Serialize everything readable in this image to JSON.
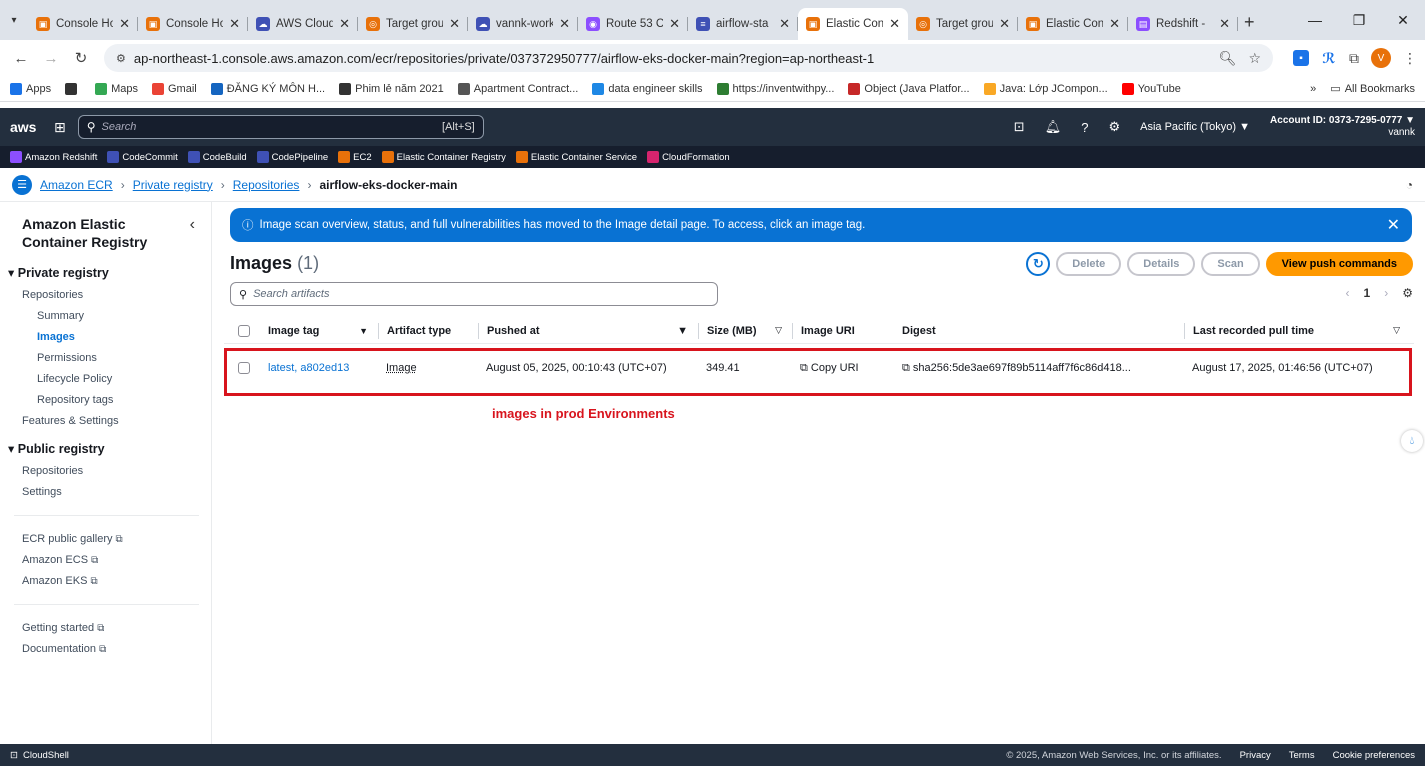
{
  "browser": {
    "tabs": [
      {
        "label": "Console Ho",
        "color": "#e8710a",
        "glyph": "▣"
      },
      {
        "label": "Console Ho",
        "color": "#e8710a",
        "glyph": "▣"
      },
      {
        "label": "AWS Cloud",
        "color": "#3f51b5",
        "glyph": "☁"
      },
      {
        "label": "Target grou",
        "color": "#e8710a",
        "glyph": "◎"
      },
      {
        "label": "vannk-work",
        "color": "#3f51b5",
        "glyph": "☁"
      },
      {
        "label": "Route 53 C",
        "color": "#8c4fff",
        "glyph": "◉"
      },
      {
        "label": "airflow-sta",
        "color": "#3f51b5",
        "glyph": "≡"
      },
      {
        "label": "Elastic Cont",
        "color": "#e8710a",
        "glyph": "▣",
        "active": true
      },
      {
        "label": "Target grou",
        "color": "#e8710a",
        "glyph": "◎"
      },
      {
        "label": "Elastic Con",
        "color": "#e8710a",
        "glyph": "▣"
      },
      {
        "label": "Redshift -",
        "color": "#8c4fff",
        "glyph": "▤"
      }
    ],
    "url": "ap-northeast-1.console.aws.amazon.com/ecr/repositories/private/037372950777/airflow-eks-docker-main?region=ap-northeast-1",
    "profile_initial": "V",
    "bookmarks": [
      {
        "label": "Apps",
        "color": "#1a73e8"
      },
      {
        "label": "",
        "color": "#333"
      },
      {
        "label": "Maps",
        "color": "#34a853"
      },
      {
        "label": "Gmail",
        "color": "#ea4335"
      },
      {
        "label": "ĐĂNG KÝ MÔN H...",
        "color": "#1565c0"
      },
      {
        "label": "Phim lẻ năm 2021",
        "color": "#333"
      },
      {
        "label": "Apartment Contract...",
        "color": "#555"
      },
      {
        "label": "data engineer skills",
        "color": "#1e88e5"
      },
      {
        "label": "https://inventwithpy...",
        "color": "#2e7d32"
      },
      {
        "label": "Object (Java Platfor...",
        "color": "#c62828"
      },
      {
        "label": "Java: Lớp JCompon...",
        "color": "#f9a825"
      },
      {
        "label": "YouTube",
        "color": "#ff0000"
      }
    ],
    "all_bookmarks": "All Bookmarks"
  },
  "aws_header": {
    "logo": "aws",
    "search_placeholder": "Search",
    "search_shortcut": "[Alt+S]",
    "region": "Asia Pacific (Tokyo) ▼",
    "account_id": "Account ID: 0373-7295-0777 ▼",
    "user": "vannk",
    "favorites": [
      {
        "label": "Amazon Redshift",
        "color": "#8c4fff"
      },
      {
        "label": "CodeCommit",
        "color": "#3f51b5"
      },
      {
        "label": "CodeBuild",
        "color": "#3f51b5"
      },
      {
        "label": "CodePipeline",
        "color": "#3f51b5"
      },
      {
        "label": "EC2",
        "color": "#e8710a"
      },
      {
        "label": "Elastic Container Registry",
        "color": "#e8710a"
      },
      {
        "label": "Elastic Container Service",
        "color": "#e8710a"
      },
      {
        "label": "CloudFormation",
        "color": "#d6246e"
      }
    ]
  },
  "breadcrumb": {
    "items": [
      "Amazon ECR",
      "Private registry",
      "Repositories"
    ],
    "current": "airflow-eks-docker-main"
  },
  "sidebar": {
    "title": "Amazon Elastic Container Registry",
    "private_registry": "Private registry",
    "private_items": [
      "Repositories"
    ],
    "private_sub": [
      "Summary",
      "Images",
      "Permissions",
      "Lifecycle Policy",
      "Repository tags"
    ],
    "features": "Features & Settings",
    "public_registry": "Public registry",
    "public_items": [
      "Repositories",
      "Settings"
    ],
    "external_links": [
      "ECR public gallery",
      "Amazon ECS",
      "Amazon EKS"
    ],
    "help_links": [
      "Getting started",
      "Documentation"
    ]
  },
  "flash": {
    "message": "Image scan overview, status, and full vulnerabilities has moved to the Image detail page. To access, click an image tag."
  },
  "images": {
    "title": "Images",
    "count": "(1)",
    "buttons": {
      "delete": "Delete",
      "details": "Details",
      "scan": "Scan",
      "push": "View push commands"
    },
    "search_placeholder": "Search artifacts",
    "page": "1",
    "columns": [
      "Image tag",
      "Artifact type",
      "Pushed at",
      "Size (MB)",
      "Image URI",
      "Digest",
      "Last recorded pull time"
    ],
    "rows": [
      {
        "tag": "latest, a802ed13",
        "artifact_type": "Image",
        "pushed_at": "August 05, 2025, 00:10:43 (UTC+07)",
        "size": "349.41",
        "uri": "Copy URI",
        "digest": "sha256:5de3ae697f89b5114aff7f6c86d418...",
        "last_pull": "August 17, 2025, 01:46:56 (UTC+07)"
      }
    ],
    "annotation": "images in prod Environments"
  },
  "footer": {
    "cloudshell": "CloudShell",
    "copyright": "© 2025, Amazon Web Services, Inc. or its affiliates.",
    "links": [
      "Privacy",
      "Terms",
      "Cookie preferences"
    ]
  }
}
